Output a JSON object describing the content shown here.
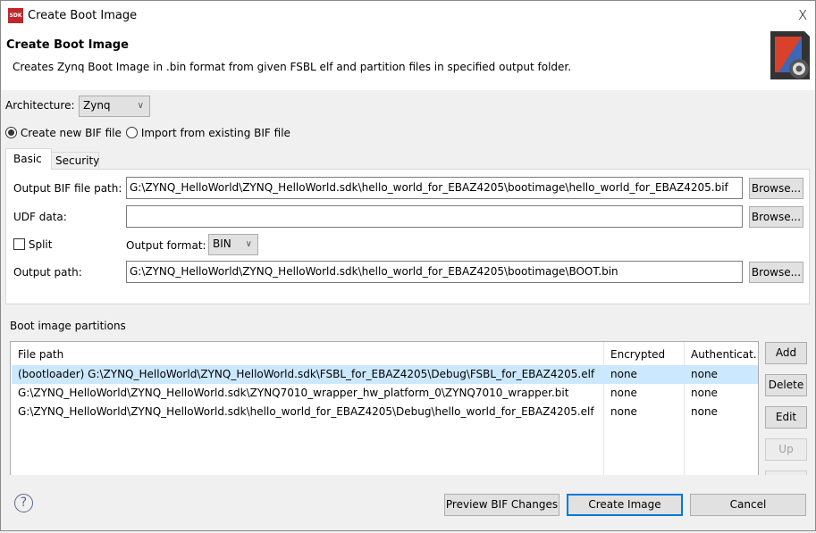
{
  "window": {
    "title": "Create Boot Image",
    "close": "X",
    "app_icon": "sdk-icon"
  },
  "header": {
    "title": "Create Boot Image",
    "description": "Creates Zynq Boot Image in .bin format from given FSBL elf and partition files in specified output folder.",
    "icon": "sd-card-gear-icon"
  },
  "architecture": {
    "label": "Architecture:",
    "value": "Zynq"
  },
  "bif_mode": {
    "options": [
      {
        "label": "Create new BIF file",
        "selected": true
      },
      {
        "label": "Import from existing BIF file",
        "selected": false
      }
    ]
  },
  "tabs": [
    {
      "label": "Basic",
      "active": true
    },
    {
      "label": "Security",
      "active": false
    }
  ],
  "basic": {
    "output_bif_label": "Output BIF file path:",
    "output_bif_value": "G:\\ZYNQ_HelloWorld\\ZYNQ_HelloWorld.sdk\\hello_world_for_EBAZ4205\\bootimage\\hello_world_for_EBAZ4205.bif",
    "udf_label": "UDF data:",
    "udf_value": "",
    "split_label": "Split",
    "split_checked": false,
    "output_format_label": "Output format:",
    "output_format_value": "BIN",
    "output_path_label": "Output path:",
    "output_path_value": "G:\\ZYNQ_HelloWorld\\ZYNQ_HelloWorld.sdk\\hello_world_for_EBAZ4205\\bootimage\\BOOT.bin",
    "browse": "Browse..."
  },
  "partitions": {
    "title": "Boot image partitions",
    "columns": [
      "File path",
      "Encrypted",
      "Authenticat..."
    ],
    "rows": [
      {
        "path": "(bootloader) G:\\ZYNQ_HelloWorld\\ZYNQ_HelloWorld.sdk\\FSBL_for_EBAZ4205\\Debug\\FSBL_for_EBAZ4205.elf",
        "encrypted": "none",
        "auth": "none",
        "selected": true
      },
      {
        "path": "G:\\ZYNQ_HelloWorld\\ZYNQ_HelloWorld.sdk\\ZYNQ7010_wrapper_hw_platform_0\\ZYNQ7010_wrapper.bit",
        "encrypted": "none",
        "auth": "none",
        "selected": false
      },
      {
        "path": "G:\\ZYNQ_HelloWorld\\ZYNQ_HelloWorld.sdk\\hello_world_for_EBAZ4205\\Debug\\hello_world_for_EBAZ4205.elf",
        "encrypted": "none",
        "auth": "none",
        "selected": false
      }
    ],
    "buttons": {
      "add": "Add",
      "delete": "Delete",
      "edit": "Edit",
      "up": "Up"
    }
  },
  "footer": {
    "preview": "Preview BIF Changes",
    "create": "Create Image",
    "cancel": "Cancel",
    "help": "?"
  },
  "colors": {
    "selection": "#cce8ff",
    "accent": "#0078d7"
  }
}
